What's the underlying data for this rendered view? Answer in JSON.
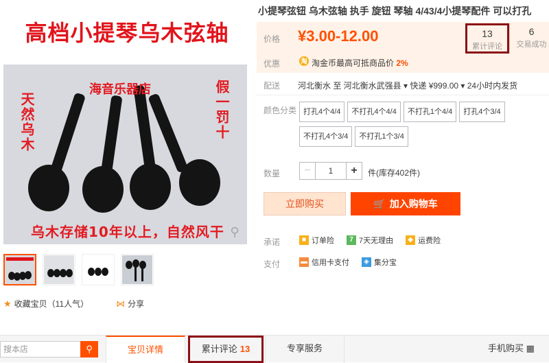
{
  "gallery": {
    "banner": "高档小提琴乌木弦轴",
    "photo_labels": {
      "shop": "海音乐器店",
      "left": "天然乌木",
      "right": "假一罚十",
      "bottom": "乌木存储10年以上，自然风干"
    },
    "fav_label": "收藏宝贝（11人气）",
    "share_label": "分享"
  },
  "product": {
    "title": "小提琴弦钮 乌木弦轴 执手 旋钮 琴轴 4/43/4小提琴配件 可以打孔",
    "price_label": "价格",
    "price": "¥3.00-12.00",
    "reviews_count": "13",
    "reviews_label": "累计评论",
    "sold_count": "6",
    "sold_label": "交易成功",
    "discount_label": "优惠",
    "discount_coin": "淘",
    "discount_text": "淘金币最高可抵商品价",
    "discount_pct": "2%",
    "ship_label": "配送",
    "ship_text": "河北衡水 至   河北衡水武强县 ▾   快递 ¥999.00 ▾   24小时内发货",
    "color_label": "颜色分类",
    "skus": [
      "打孔4个4/4",
      "不打孔4个4/4",
      "不打孔1个4/4",
      "打孔4个3/4",
      "不打孔4个3/4",
      "不打孔1个3/4"
    ],
    "qty_label": "数量",
    "qty_value": "1",
    "qty_minus": "−",
    "qty_plus": "+",
    "stock": "件(库存402件)",
    "buy_now": "立即购买",
    "add_cart": "加入购物车",
    "promise_label": "承诺",
    "promises": [
      "订单险",
      "7天无理由",
      "运费险"
    ],
    "pay_label": "支付",
    "payments": [
      "信用卡支付",
      "集分宝"
    ]
  },
  "bottom": {
    "search_placeholder": "搜本店",
    "tab_detail": "宝贝详情",
    "tab_reviews": "累计评论",
    "tab_reviews_count": "13",
    "tab_service": "专享服务",
    "tab_mobile": "手机购买",
    "qr_glyph": "▦"
  },
  "colors": {
    "accent": "#ff5000",
    "banner_red": "#e1141b",
    "highlight_box": "#8b0f16"
  }
}
